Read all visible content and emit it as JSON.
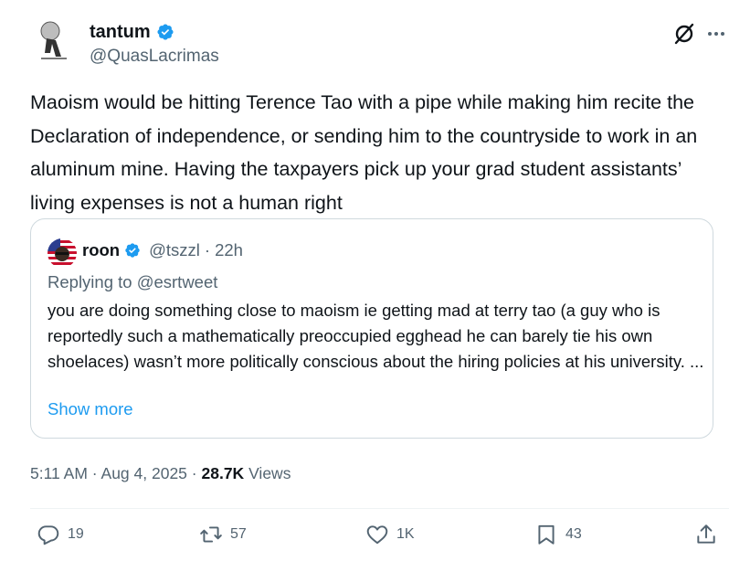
{
  "author": {
    "name": "tantum",
    "handle": "@QuasLacrimas"
  },
  "tweet": {
    "text": "Maoism would be hitting Terence Tao with a pipe while making him recite the Declaration of independence, or sending him to the countryside to work in an aluminum mine. Having the taxpayers pick up your grad student assistants’ living expenses is not a human right"
  },
  "quote": {
    "name": "roon",
    "handle": "@tszzl",
    "separator": "·",
    "time": "22h",
    "replying_to": "Replying to @esrtweet",
    "text": "you are doing something close to maoism ie getting mad at terry tao (a guy who is reportedly such a mathematically preoccupied egghead he can barely tie his own shoelaces) wasn’t more politically conscious about the hiring policies at his university. ...",
    "show_more": "Show more"
  },
  "meta": {
    "time": "5:11 AM",
    "date": "Aug 4, 2025",
    "separator": "·",
    "views_count": "28.7K",
    "views_label": "Views"
  },
  "actions": {
    "replies": "19",
    "reposts": "57",
    "likes": "1K",
    "bookmarks": "43"
  },
  "colors": {
    "accent": "#1d9bf0",
    "text": "#0f1419",
    "secondary": "#536471",
    "border": "#cfd9de"
  },
  "icons": [
    "verified-badge-icon",
    "grok-icon",
    "more-icon",
    "reply-icon",
    "repost-icon",
    "like-icon",
    "bookmark-icon",
    "share-icon"
  ]
}
